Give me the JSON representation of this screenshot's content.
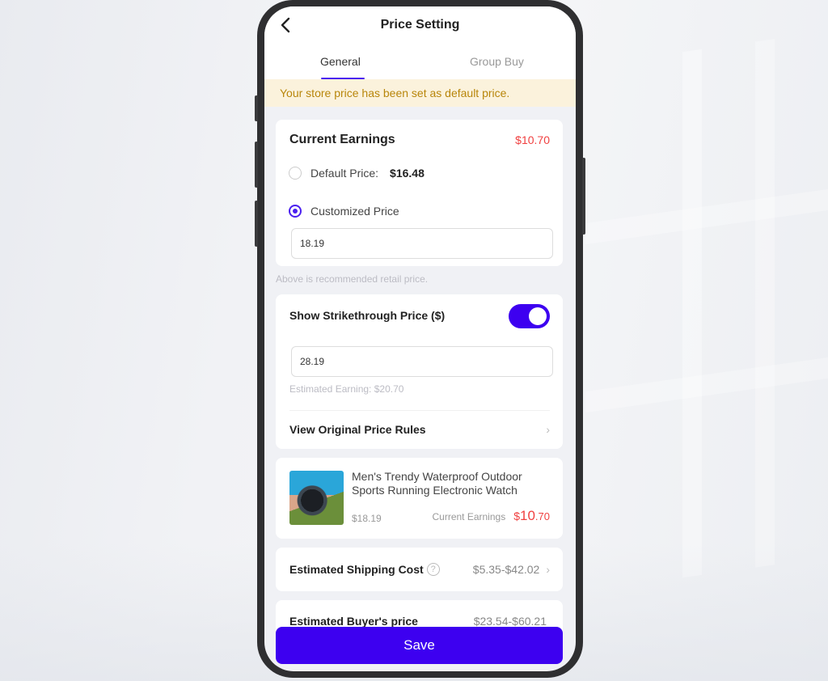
{
  "header": {
    "title": "Price Setting",
    "back_icon": "chevron-left-icon"
  },
  "tabs": [
    {
      "label": "General",
      "active": true
    },
    {
      "label": "Group Buy",
      "active": false
    }
  ],
  "notice": "Your store price has been set as default price.",
  "earnings_card": {
    "title": "Current Earnings",
    "value": "$10.70",
    "default_price_label": "Default Price:",
    "default_price_value": "$16.48",
    "default_selected": false,
    "custom_price_label": "Customized Price",
    "custom_selected": true,
    "custom_price_input": "18.19"
  },
  "hint": "Above is recommended retail price.",
  "strike_card": {
    "title": "Show Strikethrough Price ($)",
    "toggle_on": true,
    "strike_price_input": "28.19",
    "estimated_earning": "Estimated Earning: $20.70",
    "rules_label": "View Original Price Rules",
    "chevron": "›"
  },
  "product": {
    "name": "Men's Trendy Waterproof Outdoor Sports Running Electronic Watch",
    "price": "$18.19",
    "earnings_label": "Current Earnings",
    "earnings_currency": "$",
    "earnings_int": "10",
    "earnings_dec": ".70",
    "image_icon": "watch-product-image"
  },
  "shipping": {
    "label": "Estimated Shipping Cost",
    "help": "?",
    "value": "$5.35-$42.02",
    "chevron": "›"
  },
  "buyer": {
    "label": "Estimated Buyer's price",
    "value": "$23.54-$60.21"
  },
  "save_label": "Save",
  "colors": {
    "accent": "#3d00f0",
    "earnings_red": "#f04040",
    "notice_bg": "#fbf2dc",
    "notice_text": "#b8860b"
  }
}
